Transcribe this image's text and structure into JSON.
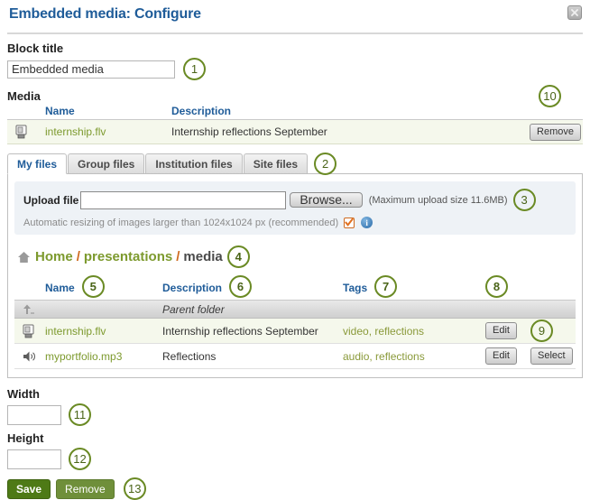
{
  "dialog": {
    "title": "Embedded media: Configure",
    "close_icon": "close-icon"
  },
  "block_title": {
    "label": "Block title",
    "value": "Embedded media",
    "placeholder": ""
  },
  "media": {
    "section_label": "Media",
    "columns": {
      "name": "Name",
      "description": "Description"
    },
    "rows": [
      {
        "icon": "video-file-icon",
        "name": "internship.flv",
        "description": "Internship reflections September",
        "action": "Remove"
      }
    ]
  },
  "tabs": [
    {
      "label": "My files",
      "active": true
    },
    {
      "label": "Group files",
      "active": false
    },
    {
      "label": "Institution files",
      "active": false
    },
    {
      "label": "Site files",
      "active": false
    }
  ],
  "upload": {
    "label": "Upload file",
    "value": "",
    "placeholder": "",
    "browse_label": "Browse...",
    "max_size_note": "(Maximum upload size 11.6MB)",
    "resize_note": "Automatic resizing of images larger than 1024x1024 px (recommended)",
    "resize_checked": true,
    "info_icon": "info-icon"
  },
  "breadcrumb": {
    "home_icon": "home-icon",
    "items": [
      {
        "label": "Home",
        "current": false
      },
      {
        "label": "presentations",
        "current": false
      },
      {
        "label": "media",
        "current": true
      }
    ],
    "separator": "/"
  },
  "file_browser": {
    "columns": {
      "name": "Name",
      "description": "Description",
      "tags": "Tags"
    },
    "parent_row": {
      "icon": "up-arrow-icon",
      "label": "Parent folder"
    },
    "rows": [
      {
        "icon": "video-file-icon",
        "name": "internship.flv",
        "description": "Internship reflections September",
        "tags": "video, reflections",
        "edit_label": "Edit",
        "select_label": ""
      },
      {
        "icon": "audio-file-icon",
        "name": "myportfolio.mp3",
        "description": "Reflections",
        "tags": "audio, reflections",
        "edit_label": "Edit",
        "select_label": "Select"
      }
    ]
  },
  "width": {
    "label": "Width",
    "value": "",
    "placeholder": ""
  },
  "height": {
    "label": "Height",
    "value": "",
    "placeholder": ""
  },
  "footer": {
    "save_label": "Save",
    "remove_label": "Remove"
  },
  "callouts": {
    "c1": "1",
    "c2": "2",
    "c3": "3",
    "c4": "4",
    "c5": "5",
    "c6": "6",
    "c7": "7",
    "c8": "8",
    "c9": "9",
    "c10": "10",
    "c11": "11",
    "c12": "12",
    "c13": "13"
  },
  "colors": {
    "title_blue": "#1f5c99",
    "link_green": "#7d9a2e",
    "callout_green": "#6a8a24",
    "accent_orange": "#cf6a20",
    "button_green": "#4e7a16"
  }
}
